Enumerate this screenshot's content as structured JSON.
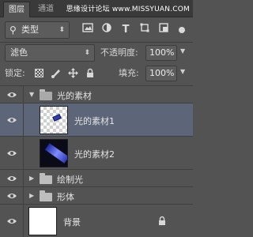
{
  "tabs": [
    {
      "label": "图层"
    },
    {
      "label": "通道"
    }
  ],
  "watermark": "思缘设计论坛 www.MISSYUAN.COM",
  "filter": {
    "label": "类型",
    "icons": [
      "image-filter-icon",
      "adjustment-filter-icon",
      "type-filter-icon",
      "shape-filter-icon",
      "smart-object-filter-icon"
    ]
  },
  "blend": {
    "mode": "滤色",
    "opacity_label": "不透明度:",
    "opacity": "100%"
  },
  "lock": {
    "label": "锁定:",
    "fill_label": "填充:",
    "fill": "100%"
  },
  "layers": [
    {
      "name": "光的素材",
      "type": "group",
      "expanded": true
    },
    {
      "name": "光的素材1",
      "type": "layer",
      "selected": true
    },
    {
      "name": "光的素材2",
      "type": "layer"
    },
    {
      "name": "绘制光",
      "type": "group",
      "expanded": false
    },
    {
      "name": "形体",
      "type": "group",
      "expanded": false
    },
    {
      "name": "背景",
      "type": "background",
      "locked": true
    }
  ],
  "colors": {
    "panel": "#535353",
    "selected": "#5d6679",
    "tabbar": "#3a3a3a"
  }
}
